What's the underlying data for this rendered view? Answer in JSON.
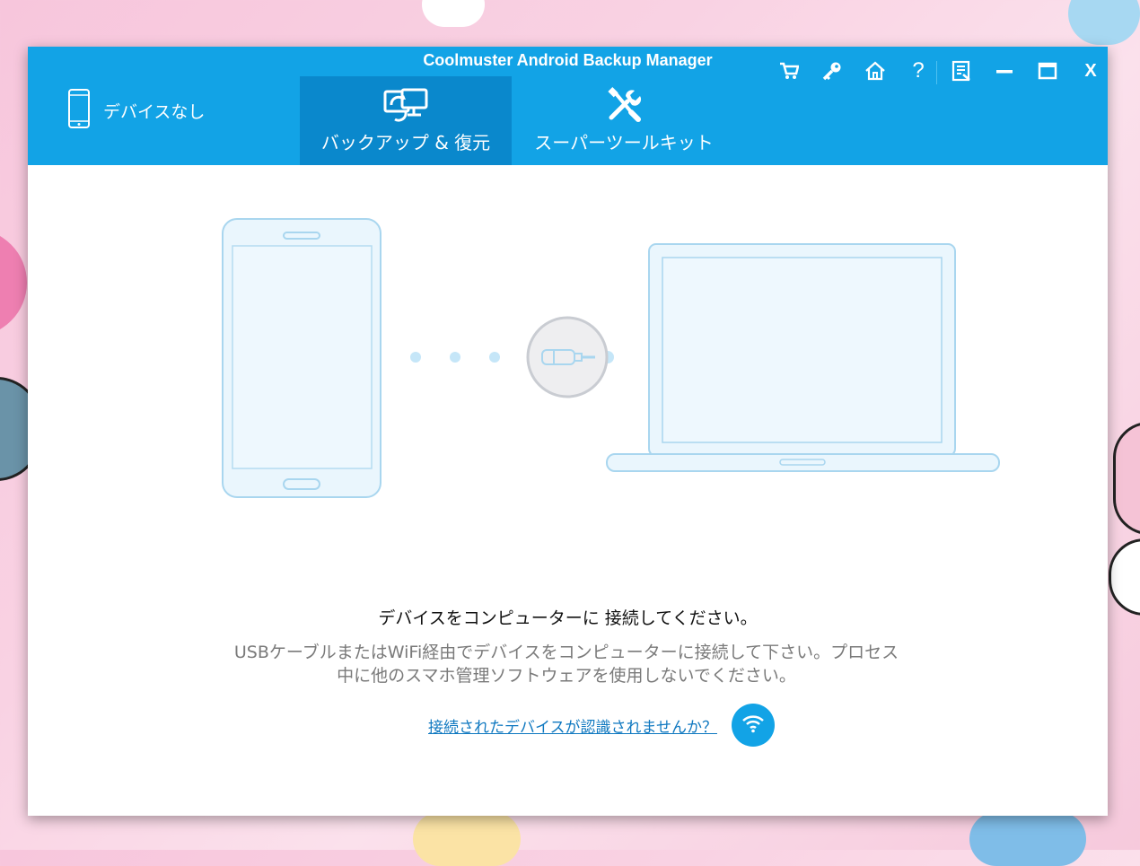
{
  "app": {
    "title": "Coolmuster Android Backup Manager"
  },
  "device": {
    "status_label": "デバイスなし"
  },
  "tabs": [
    {
      "label": "バックアップ & 復元",
      "icon": "backup-restore-icon",
      "active": true
    },
    {
      "label": "スーパーツールキット",
      "icon": "toolkit-icon",
      "active": false
    }
  ],
  "toolbar": {
    "icons": [
      "cart-icon",
      "key-icon",
      "home-icon",
      "help-icon",
      "feedback-icon",
      "minimize-icon",
      "maximize-icon",
      "close-icon"
    ],
    "help_glyph": "?",
    "close_glyph": "X"
  },
  "main": {
    "connect_title": "デバイスをコンピューターに 接続してください。",
    "instructions": "USBケーブルまたはWiFi経由でデバイスをコンピューターに接続して下さい。プロセス\n中に他のスマホ管理ソフトウェアを使用しないでください。",
    "help_link": "接続されたデバイスが認識されませんか？"
  },
  "colors": {
    "header": "#12a3e6",
    "active_tab": "#0a88cc",
    "illustration_stroke": "#a9d6ef",
    "illustration_fill": "#e9f6fd",
    "link": "#0f78c0"
  }
}
